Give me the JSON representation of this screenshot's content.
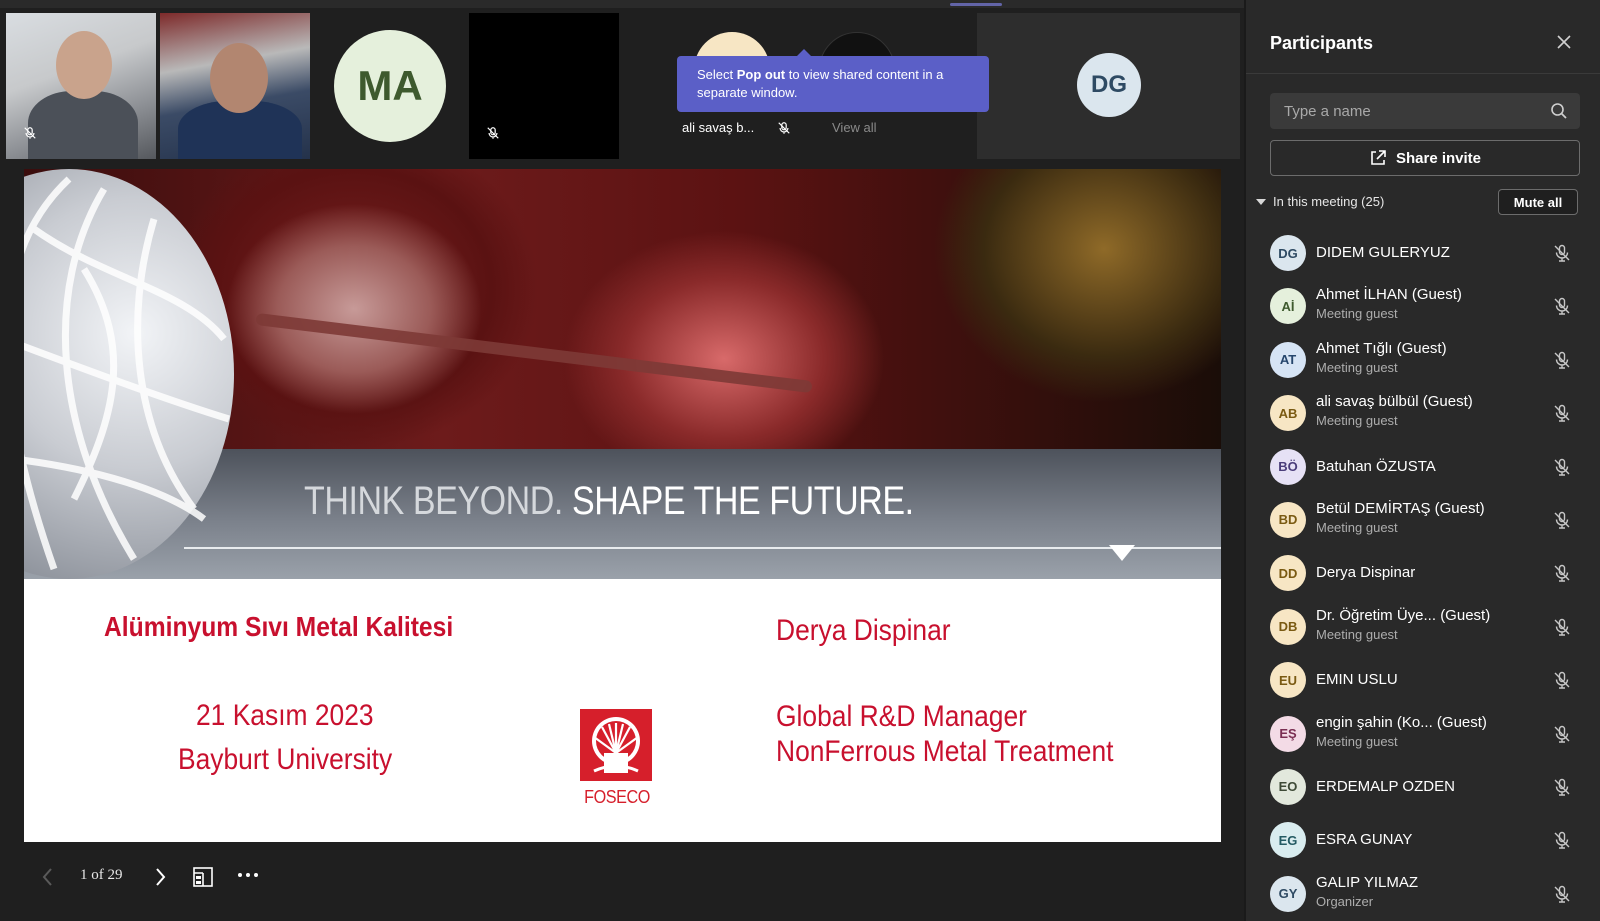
{
  "colors": {
    "background": "#1f1f1f",
    "panel": "#292929",
    "accent": "#5b5fc7",
    "slide_red": "#c8102e"
  },
  "video_strip": {
    "tile_ma_initials": "MA",
    "tile_dg_initials": "DG",
    "tooltip": {
      "prefix": "Select ",
      "bold": "Pop out",
      "suffix": " to view shared content in a separate window."
    },
    "tile_name": "ali savaş b...",
    "view_all": "View all"
  },
  "slide": {
    "slogan_part1": "THINK BEYOND. ",
    "slogan_part2": "SHAPE THE FUTURE.",
    "title": "Alüminyum Sıvı Metal Kalitesi",
    "date": "21 Kasım 2023",
    "university": "Bayburt University",
    "presenter": "Derya Dispinar",
    "role_line1": "Global R&D Manager",
    "role_line2": "NonFerrous Metal Treatment",
    "logo_text": "FOSECO"
  },
  "slide_controls": {
    "page_count": "1 of 29"
  },
  "participants_panel": {
    "title": "Participants",
    "search_placeholder": "Type a name",
    "share_invite": "Share invite",
    "section_label": "In this meeting (25)",
    "mute_all": "Mute all",
    "participants": [
      {
        "initials": "DG",
        "name": "DIDEM GULERYUZ",
        "sub": "",
        "bg": "#dbe6ee",
        "fg": "#2e4a63"
      },
      {
        "initials": "Aİ",
        "name": "Ahmet İLHAN (Guest)",
        "sub": "Meeting guest",
        "bg": "#e5f0dc",
        "fg": "#3e5a2e"
      },
      {
        "initials": "AT",
        "name": "Ahmet Tığlı (Guest)",
        "sub": "Meeting guest",
        "bg": "#d6e4f5",
        "fg": "#26466d"
      },
      {
        "initials": "AB",
        "name": "ali savaş bülbül (Guest)",
        "sub": "Meeting guest",
        "bg": "#f7e6c4",
        "fg": "#7a5a12"
      },
      {
        "initials": "BÖ",
        "name": "Batuhan ÖZUSTA",
        "sub": "",
        "bg": "#e6e1f5",
        "fg": "#4a3d7a"
      },
      {
        "initials": "BD",
        "name": "Betül DEMİRTAŞ (Guest)",
        "sub": "Meeting guest",
        "bg": "#f7e6c4",
        "fg": "#7a5a12"
      },
      {
        "initials": "DD",
        "name": "Derya Dispinar",
        "sub": "",
        "bg": "#f7e6c4",
        "fg": "#7a5a12"
      },
      {
        "initials": "DB",
        "name": "Dr. Öğretim Üye... (Guest)",
        "sub": "Meeting guest",
        "bg": "#f7e6c4",
        "fg": "#7a5a12"
      },
      {
        "initials": "EU",
        "name": "EMIN USLU",
        "sub": "",
        "bg": "#f7e6c4",
        "fg": "#7a5a12"
      },
      {
        "initials": "EŞ",
        "name": "engin şahin (Ko...  (Guest)",
        "sub": "Meeting guest",
        "bg": "#f3dbe6",
        "fg": "#7a2e52"
      },
      {
        "initials": "EO",
        "name": "ERDEMALP OZDEN",
        "sub": "",
        "bg": "#e2e8dc",
        "fg": "#3e4a36"
      },
      {
        "initials": "EG",
        "name": "ESRA GUNAY",
        "sub": "",
        "bg": "#d9ecef",
        "fg": "#245a63"
      },
      {
        "initials": "GY",
        "name": "GALIP YILMAZ",
        "sub": "Organizer",
        "bg": "#dbe6ee",
        "fg": "#2e4a63"
      }
    ]
  }
}
